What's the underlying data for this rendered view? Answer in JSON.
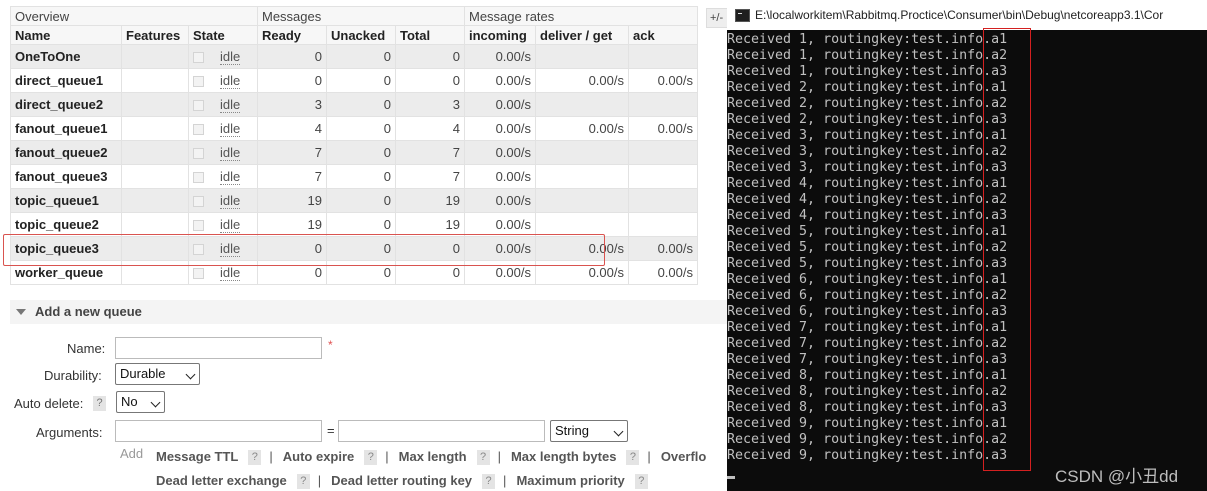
{
  "table": {
    "groups": {
      "overview": "Overview",
      "messages": "Messages",
      "rates": "Message rates",
      "toggle": "+/-"
    },
    "columns": [
      "Name",
      "Features",
      "State",
      "Ready",
      "Unacked",
      "Total",
      "incoming",
      "deliver / get",
      "ack"
    ],
    "rows": [
      {
        "name": "OneToOne",
        "state": "idle",
        "ready": "0",
        "unacked": "0",
        "total": "0",
        "incoming": "0.00/s",
        "deliver": "",
        "ack": ""
      },
      {
        "name": "direct_queue1",
        "state": "idle",
        "ready": "0",
        "unacked": "0",
        "total": "0",
        "incoming": "0.00/s",
        "deliver": "0.00/s",
        "ack": "0.00/s"
      },
      {
        "name": "direct_queue2",
        "state": "idle",
        "ready": "3",
        "unacked": "0",
        "total": "3",
        "incoming": "0.00/s",
        "deliver": "",
        "ack": ""
      },
      {
        "name": "fanout_queue1",
        "state": "idle",
        "ready": "4",
        "unacked": "0",
        "total": "4",
        "incoming": "0.00/s",
        "deliver": "0.00/s",
        "ack": "0.00/s"
      },
      {
        "name": "fanout_queue2",
        "state": "idle",
        "ready": "7",
        "unacked": "0",
        "total": "7",
        "incoming": "0.00/s",
        "deliver": "",
        "ack": ""
      },
      {
        "name": "fanout_queue3",
        "state": "idle",
        "ready": "7",
        "unacked": "0",
        "total": "7",
        "incoming": "0.00/s",
        "deliver": "",
        "ack": ""
      },
      {
        "name": "topic_queue1",
        "state": "idle",
        "ready": "19",
        "unacked": "0",
        "total": "19",
        "incoming": "0.00/s",
        "deliver": "",
        "ack": ""
      },
      {
        "name": "topic_queue2",
        "state": "idle",
        "ready": "19",
        "unacked": "0",
        "total": "19",
        "incoming": "0.00/s",
        "deliver": "",
        "ack": ""
      },
      {
        "name": "topic_queue3",
        "state": "idle",
        "ready": "0",
        "unacked": "0",
        "total": "0",
        "incoming": "0.00/s",
        "deliver": "0.00/s",
        "ack": "0.00/s"
      },
      {
        "name": "worker_queue",
        "state": "idle",
        "ready": "0",
        "unacked": "0",
        "total": "0",
        "incoming": "0.00/s",
        "deliver": "0.00/s",
        "ack": "0.00/s"
      }
    ]
  },
  "add_queue": {
    "title": "Add a new queue",
    "name_label": "Name:",
    "required_mark": "*",
    "durability_label": "Durability:",
    "durability_value": "Durable",
    "auto_delete_label": "Auto delete:",
    "auto_delete_help": "?",
    "auto_delete_value": "No",
    "arguments_label": "Arguments:",
    "equals": "=",
    "type_value": "String",
    "add_link": "Add",
    "arg_row1": [
      {
        "text": "Message TTL",
        "help": "?"
      },
      {
        "text": "Auto expire",
        "help": "?"
      },
      {
        "text": "Max length",
        "help": "?"
      },
      {
        "text": "Max length bytes",
        "help": "?"
      },
      {
        "text": "Overflo",
        "help": ""
      }
    ],
    "arg_row2": [
      {
        "text": "Dead letter exchange",
        "help": "?"
      },
      {
        "text": "Dead letter routing key",
        "help": "?"
      },
      {
        "text": "Maximum priority",
        "help": "?"
      }
    ],
    "separator": "|"
  },
  "console": {
    "title": "E:\\localworkitem\\Rabbitmq.Proctice\\Consumer\\bin\\Debug\\netcoreapp3.1\\Cor",
    "lines": [
      "Received 1, routingkey:test.info.a1",
      "Received 1, routingkey:test.info.a2",
      "Received 1, routingkey:test.info.a3",
      "Received 2, routingkey:test.info.a1",
      "Received 2, routingkey:test.info.a2",
      "Received 2, routingkey:test.info.a3",
      "Received 3, routingkey:test.info.a1",
      "Received 3, routingkey:test.info.a2",
      "Received 3, routingkey:test.info.a3",
      "Received 4, routingkey:test.info.a1",
      "Received 4, routingkey:test.info.a2",
      "Received 4, routingkey:test.info.a3",
      "Received 5, routingkey:test.info.a1",
      "Received 5, routingkey:test.info.a2",
      "Received 5, routingkey:test.info.a3",
      "Received 6, routingkey:test.info.a1",
      "Received 6, routingkey:test.info.a2",
      "Received 6, routingkey:test.info.a3",
      "Received 7, routingkey:test.info.a1",
      "Received 7, routingkey:test.info.a2",
      "Received 7, routingkey:test.info.a3",
      "Received 8, routingkey:test.info.a1",
      "Received 8, routingkey:test.info.a2",
      "Received 8, routingkey:test.info.a3",
      "Received 9, routingkey:test.info.a1",
      "Received 9, routingkey:test.info.a2",
      "Received 9, routingkey:test.info.a3"
    ],
    "watermark": "CSDN @小丑dd"
  },
  "colors": {
    "highlight": "#d9534f",
    "console_bg": "#0c0c0c",
    "console_text": "#c0c0c0"
  }
}
